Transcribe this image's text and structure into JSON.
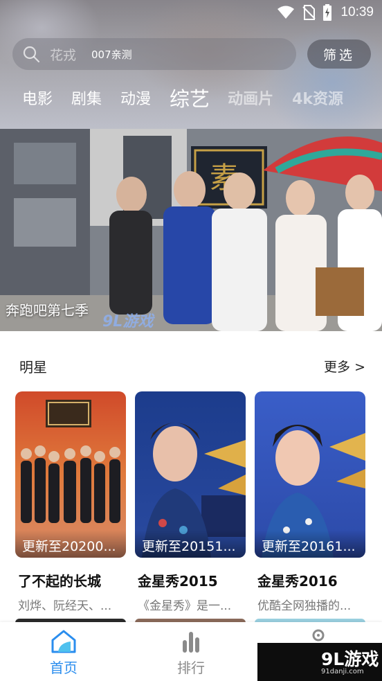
{
  "status_bar": {
    "time": "10:39"
  },
  "search": {
    "placeholder": "花戎",
    "hint": "007亲测",
    "filter_label": "筛选"
  },
  "categories": [
    {
      "label": "电影"
    },
    {
      "label": "剧集"
    },
    {
      "label": "动漫"
    },
    {
      "label": "综艺"
    },
    {
      "label": "动画片"
    },
    {
      "label": "4k资源"
    }
  ],
  "banner": {
    "title": "奔跑吧第七季",
    "watermark": "9L游戏"
  },
  "section": {
    "title": "明星",
    "more": "更多 >"
  },
  "cards": [
    {
      "update": "更新至20200...",
      "title": "了不起的长城",
      "desc": "刘烨、阮经天、..."
    },
    {
      "update": "更新至20151...",
      "title": "金星秀2015",
      "desc": "《金星秀》是一..."
    },
    {
      "update": "更新至20161...",
      "title": "金星秀2016",
      "desc": "优酷全网独播的..."
    }
  ],
  "bottom_nav": [
    {
      "label": "首页",
      "icon": "home-icon",
      "active": true
    },
    {
      "label": "排行",
      "icon": "chart-icon",
      "active": false
    },
    {
      "label": "",
      "icon": "location-icon",
      "active": false
    }
  ],
  "watermark": {
    "text": "9L游戏",
    "domain": "91danji.com"
  },
  "colors": {
    "accent": "#2a8dee",
    "inactive": "#8a8a8a"
  }
}
